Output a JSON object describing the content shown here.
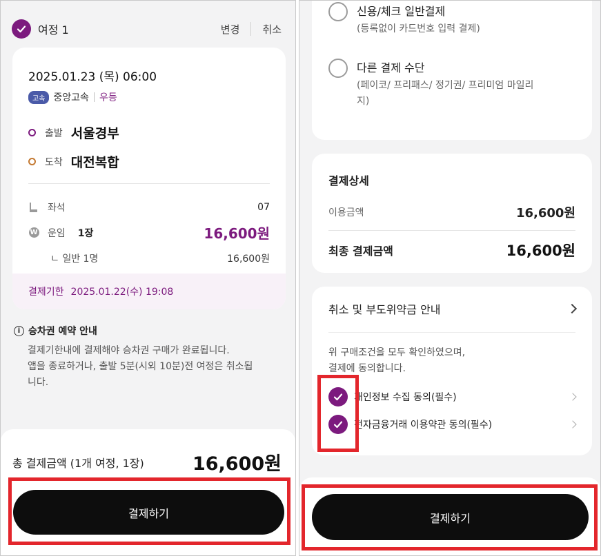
{
  "left": {
    "trip_title": "여정 1",
    "change_label": "변경",
    "cancel_label": "취소",
    "departure_datetime": "2025.01.23 (목) 06:00",
    "bus_type_badge": "고속",
    "bus_company": "중앙고속",
    "bus_grade": "우등",
    "departure": {
      "label": "출발",
      "name": "서울경부"
    },
    "arrival": {
      "label": "도착",
      "name": "대전복합"
    },
    "seat": {
      "label": "좌석",
      "value": "07"
    },
    "fare": {
      "label": "운임",
      "count": "1장",
      "value": "16,600원"
    },
    "fare_detail": {
      "label": "ㄴ 일반 1명",
      "value": "16,600원"
    },
    "deadline": {
      "label": "결제기한",
      "value": "2025.01.22(수) 19:08"
    },
    "notice": {
      "icon_text": "i",
      "title": "승차권 예약 안내",
      "line1": "결제기한내에 결제해야 승차권 구매가 완료됩니다.",
      "line2": "앱을 종료하거나, 출발 5분(시외 10분)전 여정은 취소됩",
      "line3": "니다."
    },
    "total": {
      "label": "총 결제금액 (1개 여정, 1장)",
      "value": "16,600원"
    },
    "pay_button": "결제하기"
  },
  "right": {
    "credit_card": {
      "title": "신용/체크 일반결제",
      "sub": "(등록없이 카드번호 입력 결제)"
    },
    "other_method": {
      "title": "다른 결제 수단",
      "sub1": "(페이코/ 프리패스/ 정기권/ 프리미엄 마일리",
      "sub2": "지)"
    },
    "detail": {
      "title": "결제상세",
      "usage_label": "이용금액",
      "usage_value": "16,600원",
      "final_label": "최종 결제금액",
      "final_value": "16,600원"
    },
    "agreement": {
      "header": "취소 및 부도위약금 안내",
      "text1": "위 구매조건을 모두 확인하였으며,",
      "text2": "결제에 동의합니다.",
      "items": [
        {
          "label": "개인정보 수집 동의(필수)"
        },
        {
          "label": "전자금융거래 이용약관 동의(필수)"
        }
      ]
    },
    "pay_button": "결제하기"
  },
  "icons": {
    "won_symbol": "W",
    "check": "check-icon",
    "seat": "seat-icon",
    "chevron": "chevron-right-icon"
  },
  "colors": {
    "accent": "#7c1a7e",
    "arrival_dot": "#c47a33",
    "grade_badge": "#4a5aa8",
    "button": "#0d0d0d",
    "highlight_box": "#e3262c"
  }
}
